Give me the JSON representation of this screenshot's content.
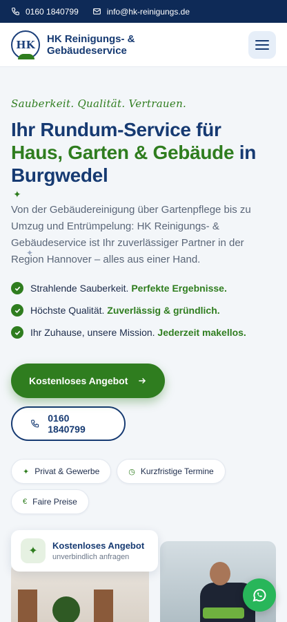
{
  "topbar": {
    "phone": "0160 1840799",
    "email": "info@hk-reinigungs.de"
  },
  "header": {
    "logo_text": "HK",
    "brand_line1": "HK Reinigungs- &",
    "brand_line2": "Gebäudeservice"
  },
  "hero": {
    "tagline": "Sauberkeit. Qualität. Vertrauen.",
    "headline_part1": "Ihr Rundum-Service für",
    "headline_green": "Haus, Garten & Gebäude",
    "headline_part2": "in",
    "headline_part3": "Burgwedel",
    "intro": "Von der Gebäudereinigung über Gartenpflege bis zu Umzug und Entrümpelung: HK Reinigungs- & Gebäudeservice ist Ihr zuverlässiger Partner in der Region Hannover – alles aus einer Hand."
  },
  "features": [
    {
      "text": "Strahlende Sauberkeit.",
      "em": "Perfekte Ergebnisse."
    },
    {
      "text": "Höchste Qualität.",
      "em": "Zuverlässig & gründlich."
    },
    {
      "text": "Ihr Zuhause, unsere Mission.",
      "em": "Jederzeit makellos."
    }
  ],
  "cta": {
    "primary_label": "Kostenloses Angebot",
    "phone_label": "0160 1840799"
  },
  "chips": [
    {
      "icon": "✦",
      "label": "Privat & Gewerbe"
    },
    {
      "icon": "◷",
      "label": "Kurzfristige Termine"
    },
    {
      "icon": "€",
      "label": "Faire Preise"
    }
  ],
  "offer_card": {
    "icon": "✦",
    "title": "Kostenloses Angebot",
    "subtitle": "unverbindlich anfragen"
  },
  "colors": {
    "navy": "#163a72",
    "green": "#2f7d1f",
    "whatsapp": "#28b65a"
  }
}
